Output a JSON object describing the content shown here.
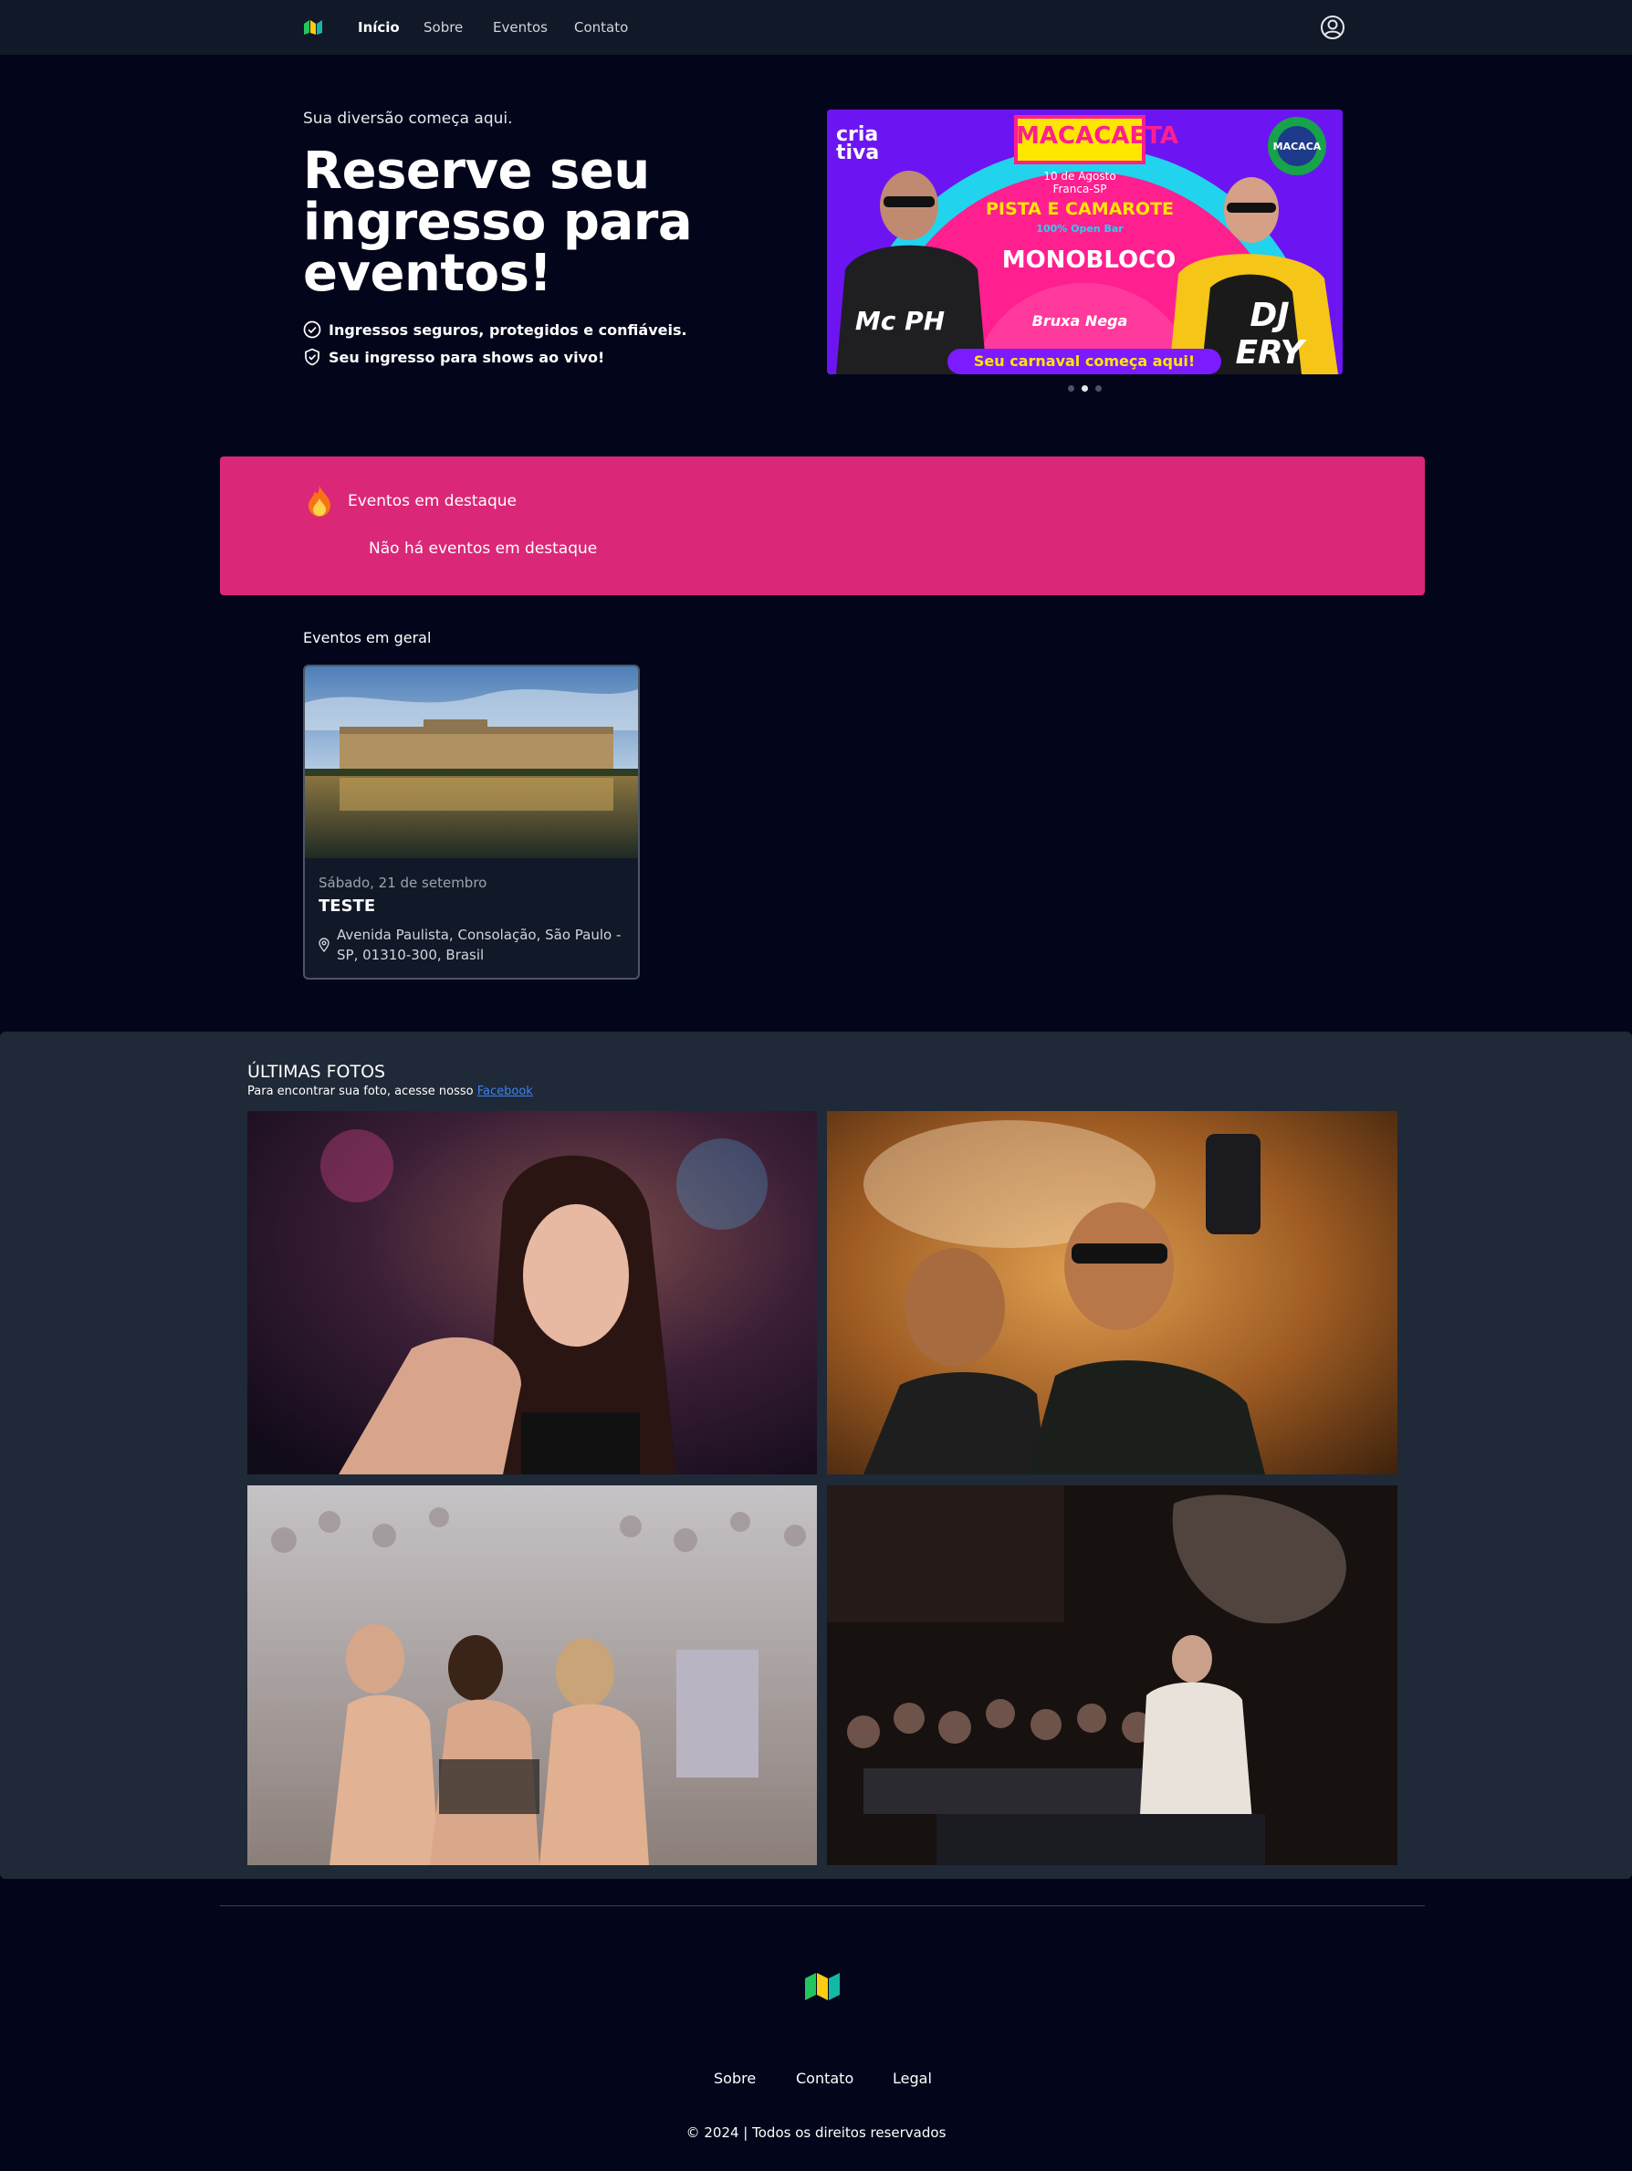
{
  "nav": {
    "logo": "brand-logo",
    "links": [
      {
        "label": "Início",
        "active": true
      },
      {
        "label": "Sobre",
        "active": false
      },
      {
        "label": "Eventos",
        "active": false
      },
      {
        "label": "Contato",
        "active": false
      }
    ],
    "user_icon": "user-circle-icon"
  },
  "hero": {
    "kicker": "Sua diversão começa aqui.",
    "title": "Reserve seu ingresso para eventos!",
    "features": [
      {
        "icon": "check-circle-icon",
        "text": "Ingressos seguros, protegidos e confiáveis."
      },
      {
        "icon": "shield-check-icon",
        "text": "Seu ingresso para shows ao vivo!"
      }
    ]
  },
  "banner": {
    "brand": "cria tiva",
    "event": "MACACAETA",
    "date": "10 de Agosto",
    "city": "Franca-SP",
    "headline": "PISTA E CAMAROTE",
    "open_bar": "100% Open Bar",
    "act": "MONOBLOCO",
    "act2": "Bruxa Nega",
    "artist_left": "Mc PH",
    "artist_right": "DJ ERY",
    "badge": "MACACA",
    "footer": "Seu carnaval começa aqui!",
    "slides": 3,
    "active_slide": 2,
    "colors": {
      "purple": "#7c1bff",
      "pink": "#ff1f8f",
      "yellow": "#ffe600",
      "cyan": "#22d3ee"
    }
  },
  "featured": {
    "icon": "fire-icon",
    "title": "Eventos em destaque",
    "empty": "Não há eventos em destaque"
  },
  "general": {
    "title": "Eventos em geral",
    "events": [
      {
        "date": "Sábado, 21 de setembro",
        "name": "TESTE",
        "address": "Avenida Paulista, Consolação, São Paulo - SP, 01310-300, Brasil",
        "icon": "map-pin-icon"
      }
    ]
  },
  "photos": {
    "title": "ÚLTIMAS FOTOS",
    "subtitle": "Para encontrar sua foto, acesse nosso",
    "link": "Facebook"
  },
  "footer": {
    "links": [
      "Sobre",
      "Contato",
      "Legal"
    ],
    "copyright": "© 2024 | Todos os direitos reservados"
  },
  "colors": {
    "background": "#03061a",
    "navbar": "#111827",
    "featured": "#db2777",
    "photos_section": "#1f2937",
    "link": "#3b82f6"
  }
}
